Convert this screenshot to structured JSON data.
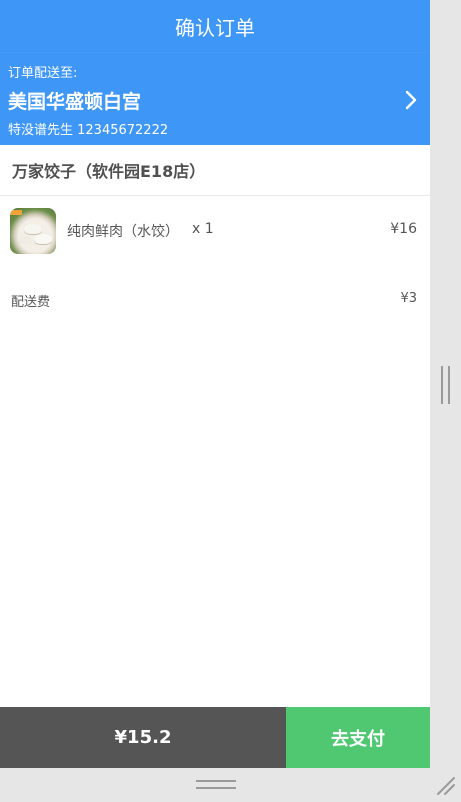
{
  "header": {
    "title": "确认订单"
  },
  "address": {
    "label": "订单配送至:",
    "place": "美国华盛顿白宫",
    "contact": "特没谱先生 12345672222",
    "chevron_icon": "chevron-right-icon"
  },
  "store": {
    "name": "万家饺子（软件园E18店）"
  },
  "order_items": [
    {
      "name": "纯肉鲜肉（水饺）",
      "quantity": "x 1",
      "price": "¥16",
      "thumbnail_icon": "dumpling-image"
    }
  ],
  "delivery_fee": {
    "label": "配送费",
    "value": "¥3"
  },
  "footer": {
    "total": "¥15.2",
    "pay_label": "去支付"
  },
  "colors": {
    "primary": "#3e96f7",
    "pay_button": "#50c872",
    "total_bar": "#555555",
    "text_gray": "#555555"
  }
}
